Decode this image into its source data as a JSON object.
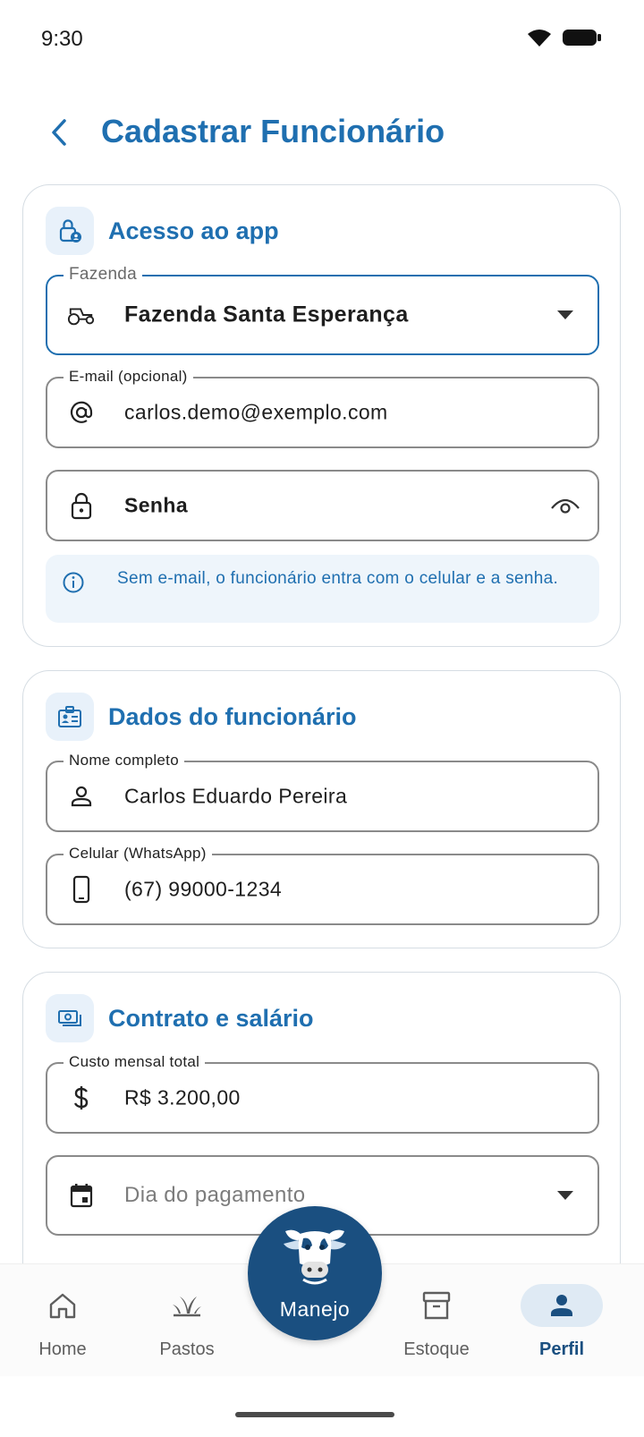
{
  "status_bar": {
    "time": "9:30"
  },
  "header": {
    "title": "Cadastrar Funcionário"
  },
  "access_section": {
    "title": "Acesso ao app",
    "farm_field": {
      "label": "Fazenda",
      "value": "Fazenda Santa Esperança"
    },
    "email_field": {
      "label": "E-mail (opcional)",
      "value": "carlos.demo@exemplo.com"
    },
    "password_field": {
      "placeholder": "Senha"
    },
    "info_text": "Sem e-mail, o funcionário entra com o celular e a senha."
  },
  "employee_section": {
    "title": "Dados do funcionário",
    "name_field": {
      "label": "Nome completo",
      "value": "Carlos Eduardo Pereira"
    },
    "phone_field": {
      "label": "Celular (WhatsApp)",
      "value": "(67) 99000-1234"
    }
  },
  "contract_section": {
    "title": "Contrato e salário",
    "cost_field": {
      "label": "Custo mensal total",
      "value": "R$ 3.200,00"
    },
    "payday_field": {
      "placeholder": "Dia do pagamento"
    }
  },
  "bottom_nav": {
    "items": [
      {
        "label": "Home",
        "icon": "home-icon"
      },
      {
        "label": "Pastos",
        "icon": "grass-icon"
      },
      {
        "label": "Estoque",
        "icon": "archive-icon"
      },
      {
        "label": "Perfil",
        "icon": "person-icon",
        "active": true
      }
    ],
    "center": {
      "label": "Manejo",
      "icon": "cow-icon"
    }
  },
  "colors": {
    "primary": "#1f6fb0",
    "nav_dark": "#1a4f80",
    "info_bg": "#eef5fb"
  }
}
